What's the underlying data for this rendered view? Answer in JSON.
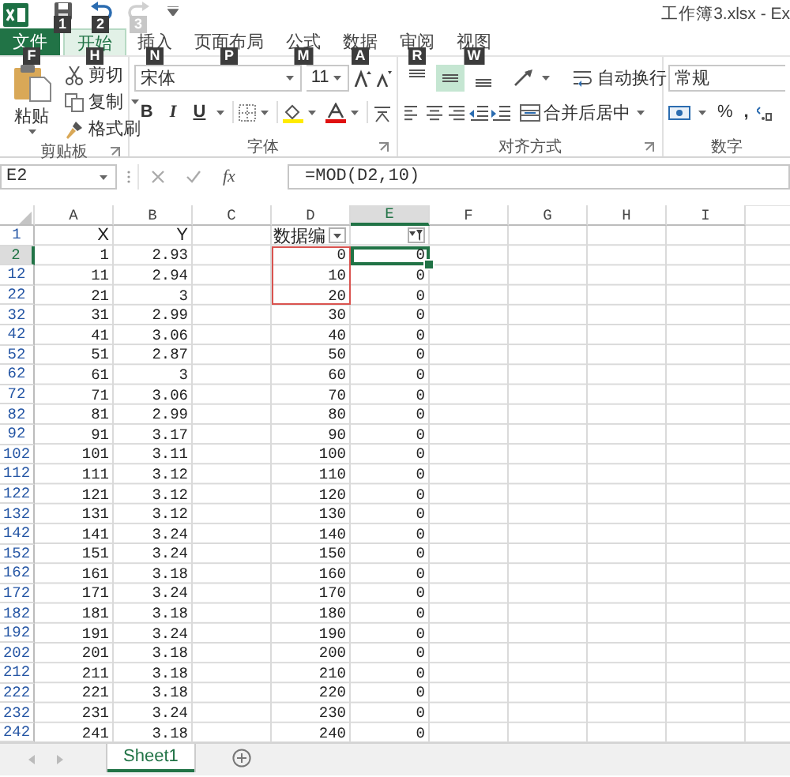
{
  "title": "工作簿3.xlsx - Ex",
  "quick_access": [
    {
      "kind": "save",
      "keytip": "1",
      "disabled": false
    },
    {
      "kind": "undo",
      "keytip": "2",
      "disabled": false
    },
    {
      "kind": "redo",
      "keytip": "3",
      "disabled": true
    }
  ],
  "tabs": [
    {
      "label": "文件",
      "keytip": "F",
      "kind": "file",
      "selected": false
    },
    {
      "label": "开始",
      "keytip": "H",
      "kind": "tab",
      "selected": true
    },
    {
      "label": "插入",
      "keytip": "N",
      "kind": "tab",
      "selected": false
    },
    {
      "label": "页面布局",
      "keytip": "P",
      "kind": "tab",
      "selected": false
    },
    {
      "label": "公式",
      "keytip": "M",
      "kind": "tab",
      "selected": false
    },
    {
      "label": "数据",
      "keytip": "A",
      "kind": "tab",
      "selected": false
    },
    {
      "label": "审阅",
      "keytip": "R",
      "kind": "tab",
      "selected": false
    },
    {
      "label": "视图",
      "keytip": "W",
      "kind": "tab",
      "selected": false
    }
  ],
  "clipboard": {
    "paste": "粘贴",
    "cut": "剪切",
    "copy": "复制",
    "format_painter": "格式刷",
    "label": "剪贴板"
  },
  "font": {
    "name": "宋体",
    "size": "11",
    "bold": "B",
    "italic": "I",
    "underline": "U",
    "label": "字体"
  },
  "alignment": {
    "vertical": [
      {
        "on": false
      },
      {
        "on": true
      },
      {
        "on": false
      }
    ],
    "wrap_text": "自动换行",
    "merge_center": "合并后居中",
    "label": "对齐方式"
  },
  "number": {
    "format": "常规",
    "percent": "%",
    "comma": ",",
    "label": "数字"
  },
  "formula_bar": {
    "name_box": "E2",
    "function_button": "fx",
    "formula": "=MOD(D2,10)"
  },
  "columns": [
    {
      "label": "A",
      "selected": false
    },
    {
      "label": "B",
      "selected": false
    },
    {
      "label": "C",
      "selected": false
    },
    {
      "label": "D",
      "selected": false
    },
    {
      "label": "E",
      "selected": true
    },
    {
      "label": "F",
      "selected": false
    },
    {
      "label": "G",
      "selected": false
    },
    {
      "label": "H",
      "selected": false
    },
    {
      "label": "I",
      "selected": false
    }
  ],
  "header_row": {
    "number": "1",
    "cells": [
      {
        "text": "X"
      },
      {
        "text": "Y"
      },
      null,
      {
        "text": "数据编",
        "filtered": false
      },
      {
        "filtered": true
      }
    ]
  },
  "rows": [
    {
      "number": "2",
      "selected": true,
      "marked": true,
      "cells": [
        "1",
        "2.93",
        null,
        "0",
        "0"
      ]
    },
    {
      "number": "12",
      "selected": false,
      "marked": true,
      "cells": [
        "11",
        "2.94",
        null,
        "10",
        "0"
      ]
    },
    {
      "number": "22",
      "selected": false,
      "marked": true,
      "cells": [
        "21",
        "3",
        null,
        "20",
        "0"
      ]
    },
    {
      "number": "32",
      "selected": false,
      "marked": false,
      "cells": [
        "31",
        "2.99",
        null,
        "30",
        "0"
      ]
    },
    {
      "number": "42",
      "selected": false,
      "marked": false,
      "cells": [
        "41",
        "3.06",
        null,
        "40",
        "0"
      ]
    },
    {
      "number": "52",
      "selected": false,
      "marked": false,
      "cells": [
        "51",
        "2.87",
        null,
        "50",
        "0"
      ]
    },
    {
      "number": "62",
      "selected": false,
      "marked": false,
      "cells": [
        "61",
        "3",
        null,
        "60",
        "0"
      ]
    },
    {
      "number": "72",
      "selected": false,
      "marked": false,
      "cells": [
        "71",
        "3.06",
        null,
        "70",
        "0"
      ]
    },
    {
      "number": "82",
      "selected": false,
      "marked": false,
      "cells": [
        "81",
        "2.99",
        null,
        "80",
        "0"
      ]
    },
    {
      "number": "92",
      "selected": false,
      "marked": false,
      "cells": [
        "91",
        "3.17",
        null,
        "90",
        "0"
      ]
    },
    {
      "number": "102",
      "selected": false,
      "marked": false,
      "cells": [
        "101",
        "3.11",
        null,
        "100",
        "0"
      ]
    },
    {
      "number": "112",
      "selected": false,
      "marked": false,
      "cells": [
        "111",
        "3.12",
        null,
        "110",
        "0"
      ]
    },
    {
      "number": "122",
      "selected": false,
      "marked": false,
      "cells": [
        "121",
        "3.12",
        null,
        "120",
        "0"
      ]
    },
    {
      "number": "132",
      "selected": false,
      "marked": false,
      "cells": [
        "131",
        "3.12",
        null,
        "130",
        "0"
      ]
    },
    {
      "number": "142",
      "selected": false,
      "marked": false,
      "cells": [
        "141",
        "3.24",
        null,
        "140",
        "0"
      ]
    },
    {
      "number": "152",
      "selected": false,
      "marked": false,
      "cells": [
        "151",
        "3.24",
        null,
        "150",
        "0"
      ]
    },
    {
      "number": "162",
      "selected": false,
      "marked": false,
      "cells": [
        "161",
        "3.18",
        null,
        "160",
        "0"
      ]
    },
    {
      "number": "172",
      "selected": false,
      "marked": false,
      "cells": [
        "171",
        "3.24",
        null,
        "170",
        "0"
      ]
    },
    {
      "number": "182",
      "selected": false,
      "marked": false,
      "cells": [
        "181",
        "3.18",
        null,
        "180",
        "0"
      ]
    },
    {
      "number": "192",
      "selected": false,
      "marked": false,
      "cells": [
        "191",
        "3.24",
        null,
        "190",
        "0"
      ]
    },
    {
      "number": "202",
      "selected": false,
      "marked": false,
      "cells": [
        "201",
        "3.18",
        null,
        "200",
        "0"
      ]
    },
    {
      "number": "212",
      "selected": false,
      "marked": false,
      "cells": [
        "211",
        "3.18",
        null,
        "210",
        "0"
      ]
    },
    {
      "number": "222",
      "selected": false,
      "marked": false,
      "cells": [
        "221",
        "3.18",
        null,
        "220",
        "0"
      ]
    },
    {
      "number": "232",
      "selected": false,
      "marked": false,
      "cells": [
        "231",
        "3.24",
        null,
        "230",
        "0"
      ]
    },
    {
      "number": "242",
      "selected": false,
      "marked": false,
      "cells": [
        "241",
        "3.18",
        null,
        "240",
        "0"
      ]
    }
  ],
  "sheets": [
    {
      "label": "Sheet1",
      "selected": true
    }
  ]
}
